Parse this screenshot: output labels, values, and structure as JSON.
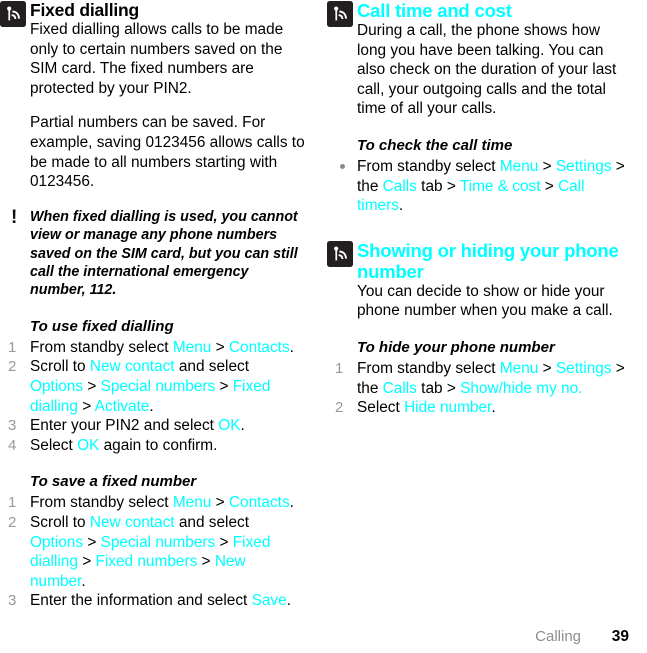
{
  "footer": {
    "chapter": "Calling",
    "page_number": "39"
  },
  "icons": {
    "feature": "signal-wave-icon",
    "note": "!"
  },
  "left_column": {
    "section": {
      "title": "Fixed dialling",
      "paragraphs": [
        "Fixed dialling allows calls to be made only to certain numbers saved on the SIM card. The fixed numbers are protected by your PIN2.",
        "Partial numbers can be saved. For example, saving 0123456 allows calls to be made to all numbers starting with 0123456."
      ],
      "note": "When fixed dialling is used, you cannot view or manage any phone numbers saved on the SIM card, but you can still call the international emergency number, 112.",
      "procedures": [
        {
          "heading": "To use fixed dialling",
          "steps": [
            {
              "num": "1",
              "parts": [
                {
                  "t": "From standby select ",
                  "k": "text"
                },
                {
                  "t": "Menu",
                  "k": "link"
                },
                {
                  "t": " > ",
                  "k": "text"
                },
                {
                  "t": "Contacts",
                  "k": "link"
                },
                {
                  "t": ".",
                  "k": "text"
                }
              ]
            },
            {
              "num": "2",
              "parts": [
                {
                  "t": "Scroll to ",
                  "k": "text"
                },
                {
                  "t": "New contact",
                  "k": "link"
                },
                {
                  "t": " and select ",
                  "k": "text"
                },
                {
                  "t": "Options",
                  "k": "link"
                },
                {
                  "t": " > ",
                  "k": "text"
                },
                {
                  "t": "Special numbers",
                  "k": "link"
                },
                {
                  "t": " > ",
                  "k": "text"
                },
                {
                  "t": "Fixed dialling",
                  "k": "link"
                },
                {
                  "t": " > ",
                  "k": "text"
                },
                {
                  "t": "Activate",
                  "k": "link"
                },
                {
                  "t": ".",
                  "k": "text"
                }
              ]
            },
            {
              "num": "3",
              "parts": [
                {
                  "t": "Enter your PIN2 and select ",
                  "k": "text"
                },
                {
                  "t": "OK",
                  "k": "link"
                },
                {
                  "t": ".",
                  "k": "text"
                }
              ]
            },
            {
              "num": "4",
              "parts": [
                {
                  "t": "Select ",
                  "k": "text"
                },
                {
                  "t": "OK",
                  "k": "link"
                },
                {
                  "t": " again to confirm.",
                  "k": "text"
                }
              ]
            }
          ]
        },
        {
          "heading": "To save a fixed number",
          "steps": [
            {
              "num": "1",
              "parts": [
                {
                  "t": "From standby select ",
                  "k": "text"
                },
                {
                  "t": "Menu",
                  "k": "link"
                },
                {
                  "t": " > ",
                  "k": "text"
                },
                {
                  "t": "Contacts",
                  "k": "link"
                },
                {
                  "t": ".",
                  "k": "text"
                }
              ]
            },
            {
              "num": "2",
              "parts": [
                {
                  "t": "Scroll to ",
                  "k": "text"
                },
                {
                  "t": "New contact",
                  "k": "link"
                },
                {
                  "t": " and select ",
                  "k": "text"
                },
                {
                  "t": "Options",
                  "k": "link"
                },
                {
                  "t": " > ",
                  "k": "text"
                },
                {
                  "t": "Special numbers",
                  "k": "link"
                },
                {
                  "t": " > ",
                  "k": "text"
                },
                {
                  "t": "Fixed dialling",
                  "k": "link"
                },
                {
                  "t": " > ",
                  "k": "text"
                },
                {
                  "t": "Fixed numbers",
                  "k": "link"
                },
                {
                  "t": " > ",
                  "k": "text"
                },
                {
                  "t": "New number",
                  "k": "link"
                },
                {
                  "t": ".",
                  "k": "text"
                }
              ]
            },
            {
              "num": "3",
              "parts": [
                {
                  "t": "Enter the information and select ",
                  "k": "text"
                },
                {
                  "t": "Save",
                  "k": "link"
                },
                {
                  "t": ".",
                  "k": "text"
                }
              ]
            }
          ]
        }
      ]
    }
  },
  "right_column": {
    "sections": [
      {
        "title": "Call time and cost",
        "title_color": "#00ffff",
        "paragraphs": [
          "During a call, the phone shows how long you have been talking. You can also check on the duration of your last call, your outgoing calls and the total time of all your calls."
        ],
        "procedures": [
          {
            "heading": "To check the call time",
            "bullets": [
              {
                "parts": [
                  {
                    "t": "From standby select ",
                    "k": "text"
                  },
                  {
                    "t": "Menu",
                    "k": "link"
                  },
                  {
                    "t": " > ",
                    "k": "text"
                  },
                  {
                    "t": "Settings",
                    "k": "link"
                  },
                  {
                    "t": " > the ",
                    "k": "text"
                  },
                  {
                    "t": "Calls",
                    "k": "link"
                  },
                  {
                    "t": " tab > ",
                    "k": "text"
                  },
                  {
                    "t": "Time & cost",
                    "k": "link"
                  },
                  {
                    "t": " > ",
                    "k": "text"
                  },
                  {
                    "t": "Call timers",
                    "k": "link"
                  },
                  {
                    "t": ".",
                    "k": "text"
                  }
                ]
              }
            ]
          }
        ]
      },
      {
        "title": "Showing or hiding your phone number",
        "title_color": "#00ffff",
        "paragraphs": [
          "You can decide to show or hide your phone number when you make a call."
        ],
        "procedures": [
          {
            "heading": "To hide your phone number",
            "steps": [
              {
                "num": "1",
                "parts": [
                  {
                    "t": "From standby select ",
                    "k": "text"
                  },
                  {
                    "t": "Menu",
                    "k": "link"
                  },
                  {
                    "t": " > ",
                    "k": "text"
                  },
                  {
                    "t": "Settings",
                    "k": "link"
                  },
                  {
                    "t": " > the ",
                    "k": "text"
                  },
                  {
                    "t": "Calls",
                    "k": "link"
                  },
                  {
                    "t": " tab > ",
                    "k": "text"
                  },
                  {
                    "t": "Show/hide my no.",
                    "k": "link"
                  },
                  {
                    "t": "",
                    "k": "text"
                  }
                ]
              },
              {
                "num": "2",
                "parts": [
                  {
                    "t": "Select ",
                    "k": "text"
                  },
                  {
                    "t": "Hide number",
                    "k": "link"
                  },
                  {
                    "t": ".",
                    "k": "text"
                  }
                ]
              }
            ]
          }
        ]
      }
    ]
  }
}
